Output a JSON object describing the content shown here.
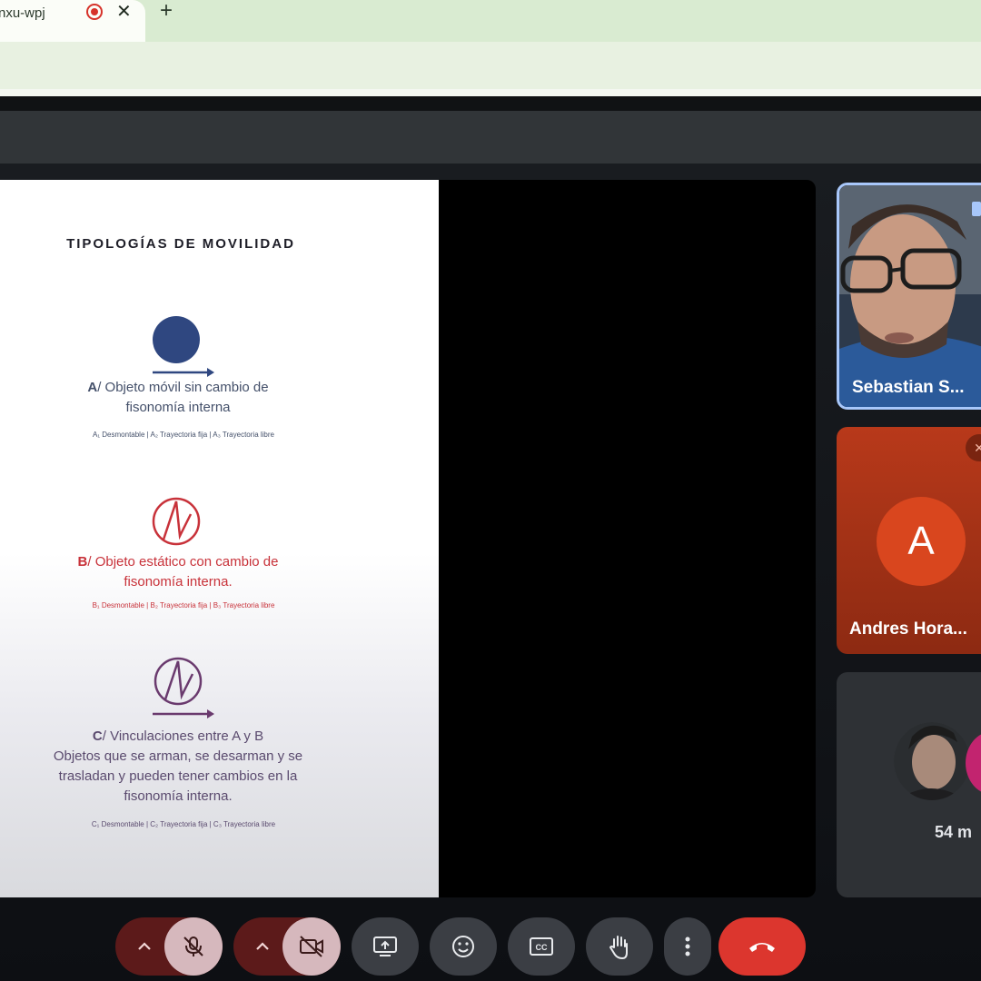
{
  "browser": {
    "tab_title": "nxu-wpj",
    "recording_icon": "record-icon",
    "close_icon": "close-icon",
    "new_tab_label": "+"
  },
  "slide": {
    "title": "TIPOLOGÍAS DE MOVILIDAD",
    "item_a": {
      "letter": "A",
      "line1": "/ Objeto móvil sin cambio de",
      "line2": "fisonomía interna",
      "sub": "A₁ Desmontable | A₂ Trayectoria fija | A₃ Trayectoria libre",
      "icon": "filled-circle-with-arrow-icon"
    },
    "item_b": {
      "letter": "B",
      "line1": "/ Objeto estático con cambio de",
      "line2": "fisonomía interna.",
      "sub": "B₁ Desmontable | B₂ Trayectoria fija | B₃ Trayectoria libre",
      "icon": "circle-with-zigzag-icon"
    },
    "item_c": {
      "letter": "C",
      "line1": "/ Vinculaciones entre A y B",
      "line2": "Objetos que se arman, se desarman y se",
      "line3": "trasladan y pueden tener cambios en la",
      "line4": "fisonomía interna.",
      "sub": "C₁ Desmontable | C₂ Trayectoria fija | C₃ Trayectoria libre",
      "icon": "circle-with-zigzag-and-arrow-icon"
    }
  },
  "participants": [
    {
      "name": "Sebastian S..."
    },
    {
      "name": "Andres Hora...",
      "initial": "A"
    },
    {
      "name": "54 m"
    }
  ],
  "controls": {
    "mic": "mic-off-icon",
    "camera": "camera-off-icon",
    "present": "present-screen-icon",
    "emoji": "emoji-icon",
    "captions": "captions-icon",
    "hand": "raise-hand-icon",
    "more": "more-options-icon",
    "leave": "leave-call-icon"
  },
  "colors": {
    "navy": "#2f4780",
    "red": "#c8323a",
    "purple": "#6a3a6e",
    "leave": "#dc362e",
    "accent_border": "#a8c7fa"
  }
}
